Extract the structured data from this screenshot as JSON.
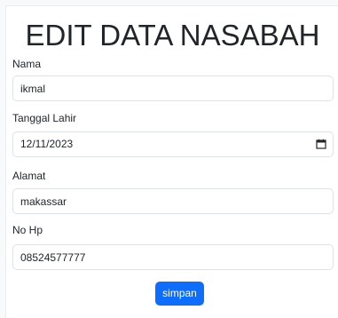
{
  "form": {
    "title": "EDIT DATA NASABAH",
    "fields": {
      "nama": {
        "label": "Nama",
        "value": "ikmal"
      },
      "tanggal_lahir": {
        "label": "Tanggal Lahir",
        "value": "12/11/2023"
      },
      "alamat": {
        "label": "Alamat",
        "value": "makassar"
      },
      "no_hp": {
        "label": "No Hp",
        "value": "08524577777"
      }
    },
    "submit_label": "simpan"
  },
  "colors": {
    "accent": "#0d6efd",
    "input_border": "#dee2e6",
    "page_background": "#f8f9fa"
  },
  "icons": {
    "date_picker": "calendar-icon"
  }
}
